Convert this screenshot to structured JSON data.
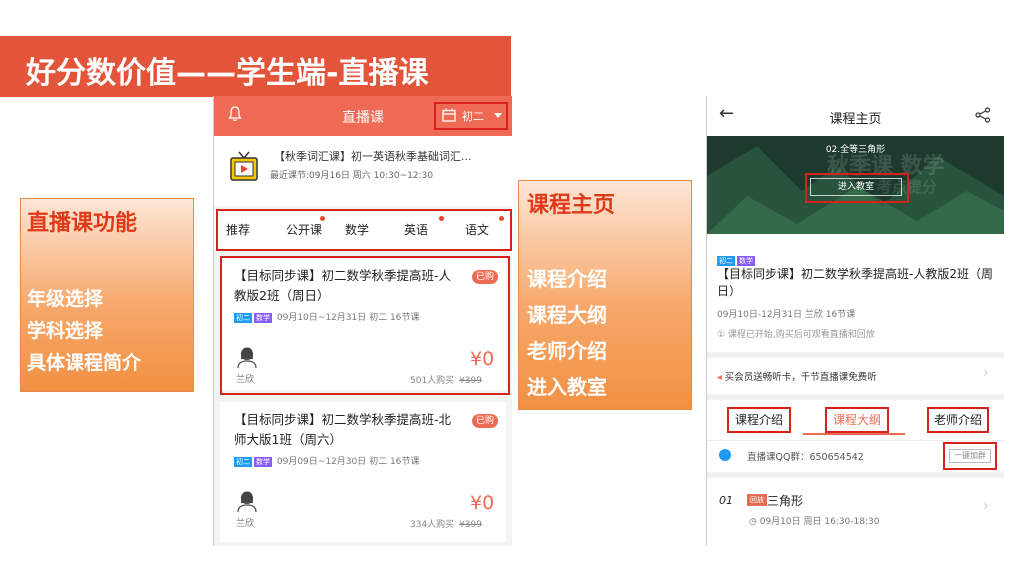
{
  "slide": {
    "title": "好分数价值——学生端-直播课"
  },
  "callout_left": {
    "title": "直播课功能",
    "lines": [
      "年级选择",
      "学科选择",
      "具体课程简介"
    ]
  },
  "callout_right": {
    "title": "课程主页",
    "lines": [
      "课程介绍",
      "课程大纲",
      "老师介绍",
      "进入教室"
    ]
  },
  "live_page": {
    "header_title": "直播课",
    "grade": "初二",
    "notice_title": "【秋季词汇课】初一英语秋季基础词汇...",
    "notice_time": "最近课节:09月16日 周六 10:30~12:30",
    "subjects": [
      "推荐",
      "公开课",
      "数学",
      "英语",
      "语文"
    ],
    "cards": [
      {
        "title": "【目标同步课】初二数学秋季提高班-人教版2班（周日）",
        "badge": "已购",
        "tags": [
          "初二",
          "数学"
        ],
        "info": "09月10日~12月31日  初二  16节课",
        "teacher": "兰欣",
        "price": "¥0",
        "buyers": "501人购买",
        "orig_price": "¥399"
      },
      {
        "title": "【目标同步课】初二数学秋季提高班-北师大版1班（周六）",
        "badge": "已购",
        "tags": [
          "初二",
          "数学"
        ],
        "info": "09月09日~12月30日  初二  16节课",
        "teacher": "兰欣",
        "price": "¥0",
        "buyers": "334人购买",
        "orig_price": "¥399"
      }
    ]
  },
  "course_page": {
    "header_title": "课程主页",
    "back_icon": "←",
    "hero_sub": "02.全等三角形",
    "hero_watermark": "秋季课 数学",
    "hero_watermark2": "考点提分",
    "enter_button": "进入教室",
    "tags": [
      "初二",
      "数学"
    ],
    "course_title": "【目标同步课】初二数学秋季提高班-人教版2班（周日）",
    "dates": "09月10日-12月31日  兰欣  16节课",
    "hint": "① 课程已开始,购买后可观看直播和回放",
    "promo": "买会员送畅听卡，千节直播课免费听",
    "tabs": [
      "课程介绍",
      "课程大纲",
      "老师介绍"
    ],
    "qq_group": "直播课QQ群：650654542",
    "join_button": "一键加群",
    "lesson": {
      "num": "01",
      "badge": "回放",
      "name": "三角形",
      "time": "09月10日  周日  16:30-18:30"
    }
  },
  "colors": {
    "brand": "#ef6a54",
    "banner": "#e2553a",
    "highlight_border": "#d8201c",
    "callout_title": "#e03a1a"
  },
  "icons": [
    "bell-icon",
    "calendar-icon",
    "tv-icon",
    "avatar-icon",
    "back-arrow-icon",
    "share-icon",
    "qq-icon",
    "clock-icon",
    "chevron-right-icon"
  ]
}
